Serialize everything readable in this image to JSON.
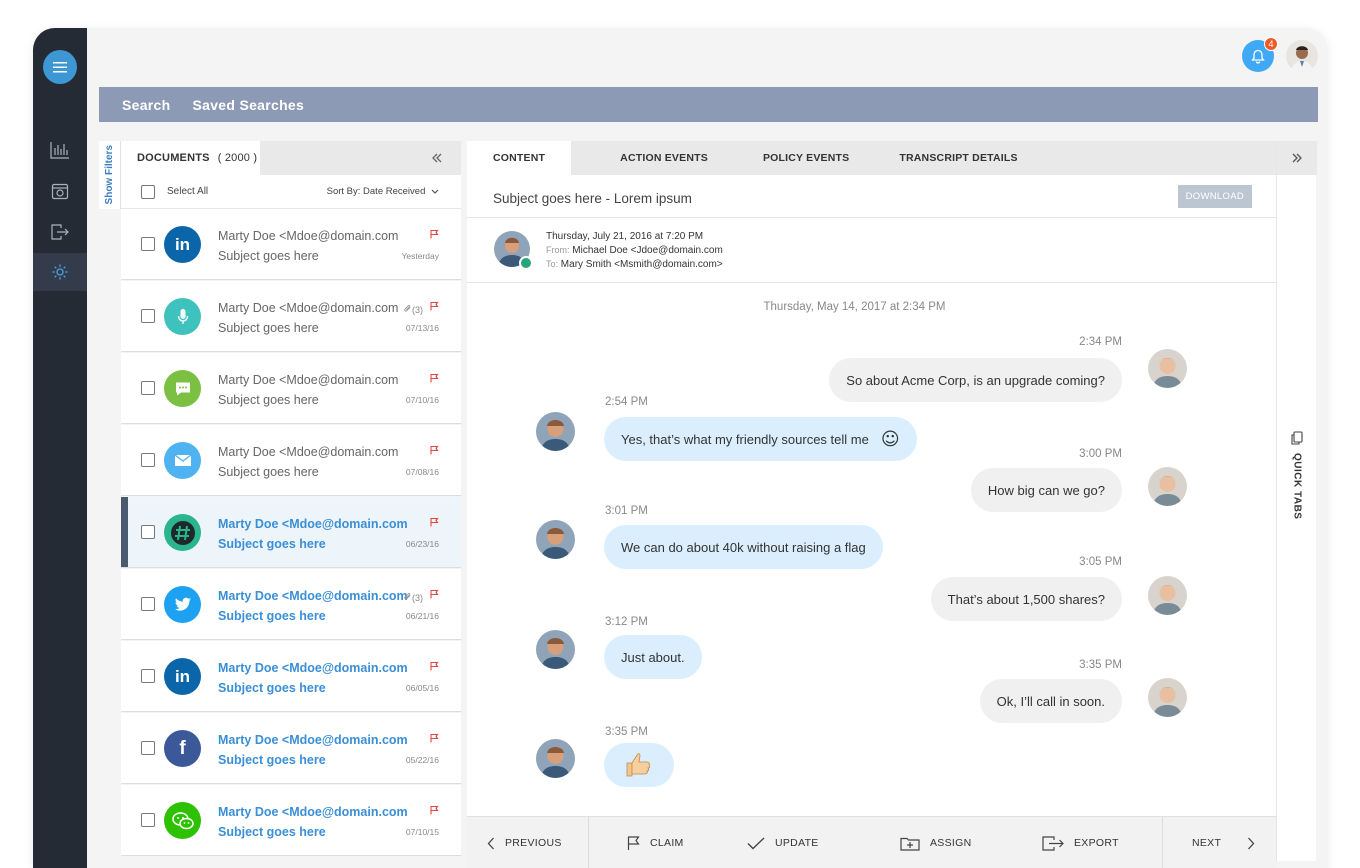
{
  "notifications": {
    "count": "4"
  },
  "searchbar": {
    "search": "Search",
    "saved": "Saved Searches"
  },
  "filters": {
    "label": "Show Filters"
  },
  "documents": {
    "title": "DOCUMENTS",
    "count": "( 2000 )",
    "select_all": "Select All",
    "sort_by": "Sort By: Date Received",
    "items": [
      {
        "from": "Marty Doe <Mdoe@domain.com",
        "subject": "Subject goes here",
        "date": "Yesterday",
        "channel": "linkedin",
        "attachments": ""
      },
      {
        "from": "Marty Doe <Mdoe@domain.com",
        "subject": "Subject goes here",
        "date": "07/13/16",
        "channel": "voice",
        "attachments": "(3)"
      },
      {
        "from": "Marty Doe <Mdoe@domain.com",
        "subject": "Subject goes here",
        "date": "07/10/16",
        "channel": "chat",
        "attachments": ""
      },
      {
        "from": "Marty Doe <Mdoe@domain.com",
        "subject": "Subject goes here",
        "date": "07/08/16",
        "channel": "email",
        "attachments": ""
      },
      {
        "from": "Marty Doe <Mdoe@domain.com",
        "subject": "Subject goes here",
        "date": "06/23/16",
        "channel": "slack",
        "attachments": ""
      },
      {
        "from": "Marty Doe <Mdoe@domain.com",
        "subject": "Subject goes here",
        "date": "06/21/16",
        "channel": "twitter",
        "attachments": "(3)"
      },
      {
        "from": "Marty Doe <Mdoe@domain.com",
        "subject": "Subject goes here",
        "date": "06/05/16",
        "channel": "linkedin",
        "attachments": ""
      },
      {
        "from": "Marty Doe <Mdoe@domain.com",
        "subject": "Subject goes here",
        "date": "05/22/16",
        "channel": "facebook",
        "attachments": ""
      },
      {
        "from": "Marty Doe <Mdoe@domain.com",
        "subject": "Subject goes here",
        "date": "07/10/15",
        "channel": "wechat",
        "attachments": ""
      }
    ]
  },
  "tabs": [
    "CONTENT",
    "ACTION EVENTS",
    "POLICY EVENTS",
    "TRANSCRIPT DETAILS"
  ],
  "content": {
    "subject": "Subject goes here - Lorem ipsum",
    "download": "DOWNLOAD",
    "meta_date": "Thursday, July 21, 2016 at 7:20 PM",
    "from_label": "From:",
    "from": "Michael Doe <Jdoe@domain.com",
    "to_label": "To:",
    "to": "Mary Smith <Msmith@domain.com>",
    "conversation_date": "Thursday, May 14, 2017 at 2:34 PM"
  },
  "messages": [
    {
      "dir": "out",
      "time": "2:34 PM",
      "text": "So about Acme Corp, is an upgrade coming?"
    },
    {
      "dir": "in",
      "time": "2:54 PM",
      "text": "Yes, that’s what my friendly sources tell me",
      "emoji": "☺"
    },
    {
      "dir": "out",
      "time": "3:00 PM",
      "text": "How big can we go?"
    },
    {
      "dir": "in",
      "time": "3:01 PM",
      "text": "We can do about 40k without raising a flag"
    },
    {
      "dir": "out",
      "time": "3:05 PM",
      "text": "That’s about 1,500 shares?"
    },
    {
      "dir": "in",
      "time": "3:12 PM",
      "text": "Just about."
    },
    {
      "dir": "out",
      "time": "3:35 PM",
      "text": "Ok, I’ll call in soon."
    },
    {
      "dir": "in",
      "time": "3:35 PM",
      "text": "",
      "emoji": "👍"
    }
  ],
  "quick_tabs": "QUICK TABS",
  "footer": {
    "previous": "PREVIOUS",
    "claim": "CLAIM",
    "update": "UPDATE",
    "assign": "ASSIGN",
    "export": "EXPORT",
    "next": "NEXT"
  },
  "colors": {
    "sidebar": "#252b35",
    "accent": "#3d97d3",
    "searchbar": "#8c9ab5",
    "unread": "#3a8fd7",
    "bubble_in": "#dbeefd",
    "bubble_out": "#f0f0f0"
  }
}
